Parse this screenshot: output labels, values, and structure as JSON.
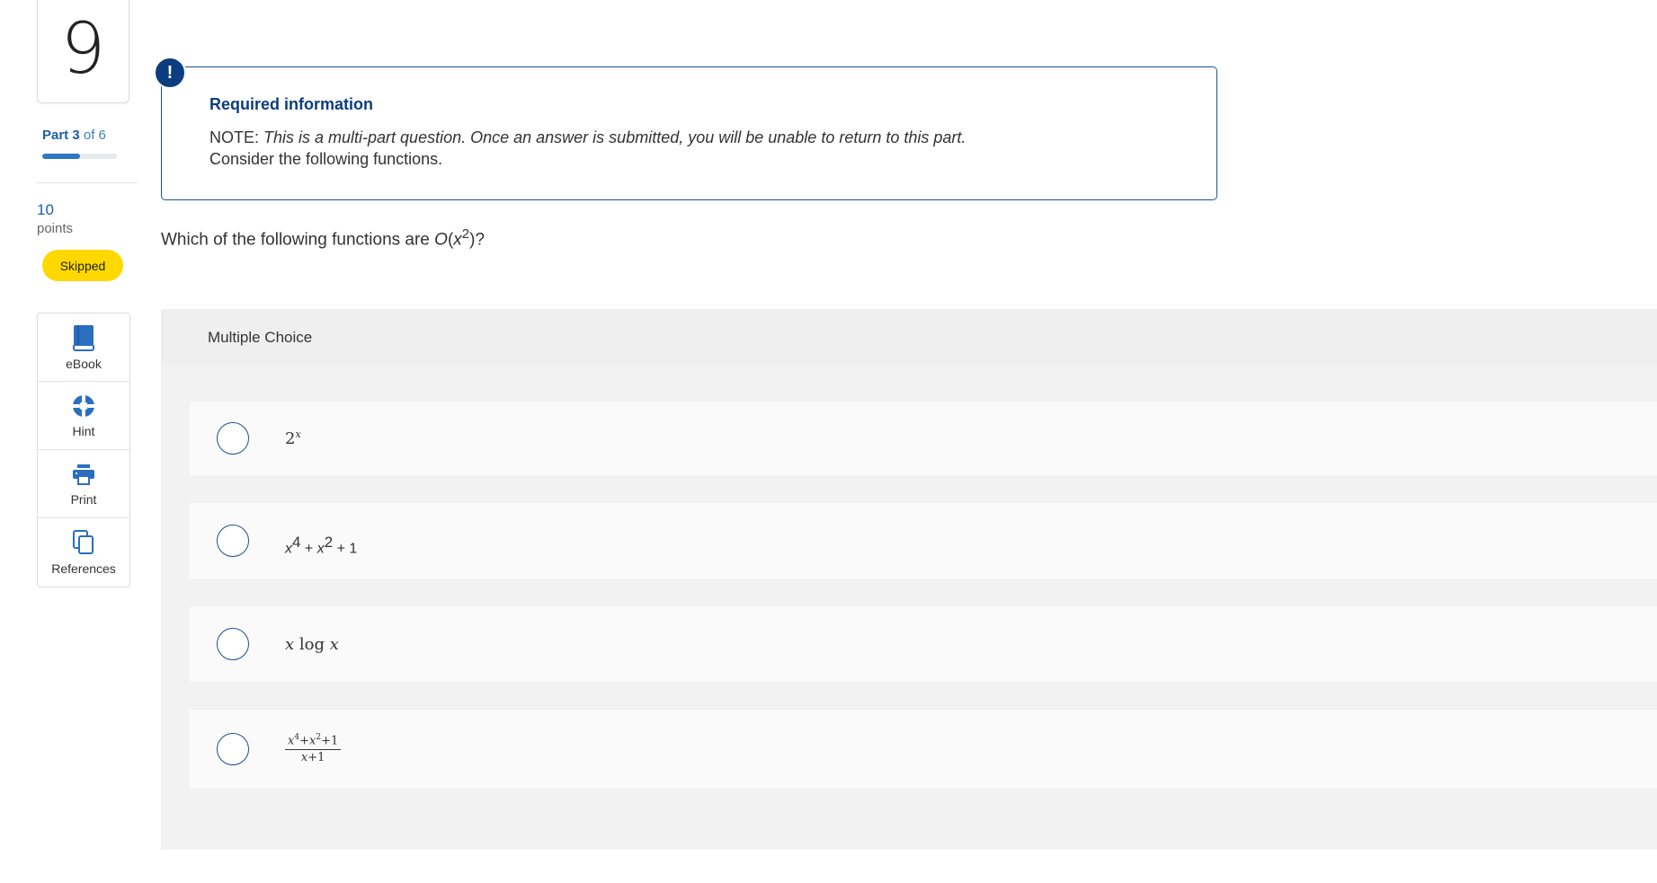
{
  "question": {
    "number": "9",
    "part_prefix": "Part 3",
    "part_suffix": " of 6",
    "part_progress_fraction": 0.5,
    "points_value": "10",
    "points_label": "points",
    "status": "Skipped"
  },
  "tools": [
    {
      "label": "eBook",
      "icon": "book-icon"
    },
    {
      "label": "Hint",
      "icon": "lifebuoy-icon"
    },
    {
      "label": "Print",
      "icon": "printer-icon"
    },
    {
      "label": "References",
      "icon": "copy-documents-icon"
    }
  ],
  "info": {
    "title": "Required information",
    "note_prefix": "NOTE: ",
    "note_text": "This is a multi-part question. Once an answer is submitted, you will be unable to return to this part.",
    "consider": "Consider the following functions."
  },
  "prompt": {
    "before": "Which of the following functions are ",
    "big_o": "O",
    "open": "(",
    "var": "x",
    "exp": "2",
    "close": ")?"
  },
  "multiple_choice": {
    "header": "Multiple Choice",
    "choices": [
      {
        "base": "2",
        "exp": "x"
      },
      {
        "t1": "x",
        "e1": "4",
        "plus1": " + ",
        "t2": "x",
        "e2": "2",
        "rest": " + 1"
      },
      {
        "a": "x",
        "log": " log ",
        "b": "x"
      },
      {
        "num_x": "x",
        "num_e1": "4",
        "num_mid": "+",
        "num_x2": "x",
        "num_e2": "2",
        "num_rest": "+1",
        "den_x": "x",
        "den_rest": "+1"
      }
    ]
  },
  "colors": {
    "accent": "#1d5091",
    "alert_bg": "#0b3e7e",
    "badge": "#ffd800",
    "link": "#3f7cc2"
  }
}
